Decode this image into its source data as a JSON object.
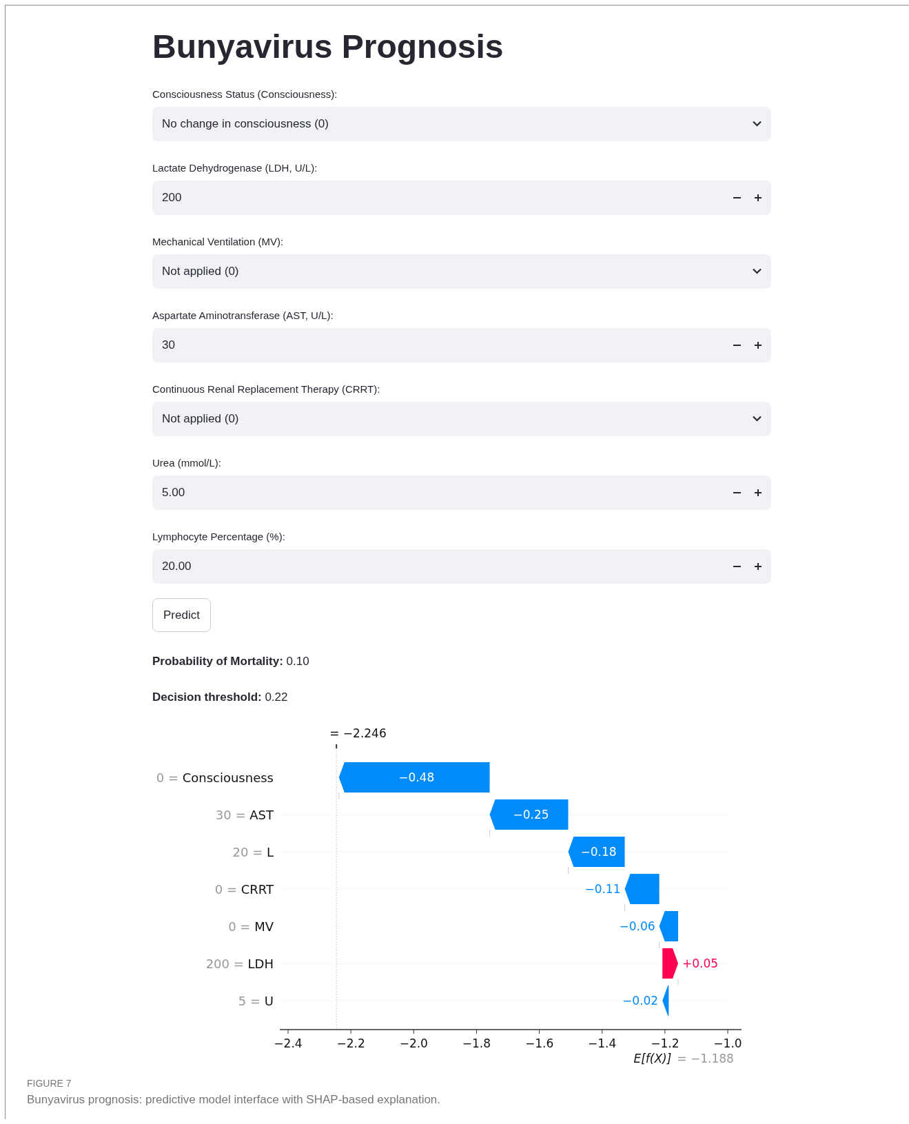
{
  "title": "Bunyavirus Prognosis",
  "fields": [
    {
      "kind": "select",
      "label": "Consciousness Status (Consciousness):",
      "value": "No change in consciousness (0)"
    },
    {
      "kind": "number",
      "label": "Lactate Dehydrogenase (LDH, U/L):",
      "value": "200"
    },
    {
      "kind": "select",
      "label": "Mechanical Ventilation (MV):",
      "value": "Not applied (0)"
    },
    {
      "kind": "number",
      "label": "Aspartate Aminotransferase (AST, U/L):",
      "value": "30"
    },
    {
      "kind": "select",
      "label": "Continuous Renal Replacement Therapy (CRRT):",
      "value": "Not applied (0)"
    },
    {
      "kind": "number",
      "label": "Urea (mmol/L):",
      "value": "5.00"
    },
    {
      "kind": "number",
      "label": "Lymphocyte Percentage (%):",
      "value": "20.00"
    }
  ],
  "predict_button": "Predict",
  "results": [
    "**Probability of Mortality:** 0.10",
    "**Decision threshold:** 0.22"
  ],
  "waterfall": {
    "prediction_label": "= −2.246",
    "rows": [
      {
        "feature_value": "0 =",
        "feature": "Consciousness",
        "contribution": "−0.48"
      },
      {
        "feature_value": "30 =",
        "feature": "AST",
        "contribution": "−0.25"
      },
      {
        "feature_value": "20 =",
        "feature": "L",
        "contribution": "−0.18"
      },
      {
        "feature_value": "0 =",
        "feature": "CRRT",
        "contribution": "−0.11"
      },
      {
        "feature_value": "0 =",
        "feature": "MV",
        "contribution": "−0.06"
      },
      {
        "feature_value": "200 =",
        "feature": "LDH",
        "contribution": "+0.05"
      },
      {
        "feature_value": "5 =",
        "feature": "U",
        "contribution": "−0.02"
      }
    ],
    "x_ticks": [
      "−2.4",
      "−2.2",
      "−2.0",
      "−1.8",
      "−1.6",
      "−1.4",
      "−1.2",
      "−1.0"
    ],
    "expected_label": "E[f(X)]",
    "expected_value": "= −1.188"
  },
  "caption": {
    "label": "FIGURE 7",
    "text": "Bunyavirus prognosis: predictive model interface with SHAP-based explanation."
  }
}
